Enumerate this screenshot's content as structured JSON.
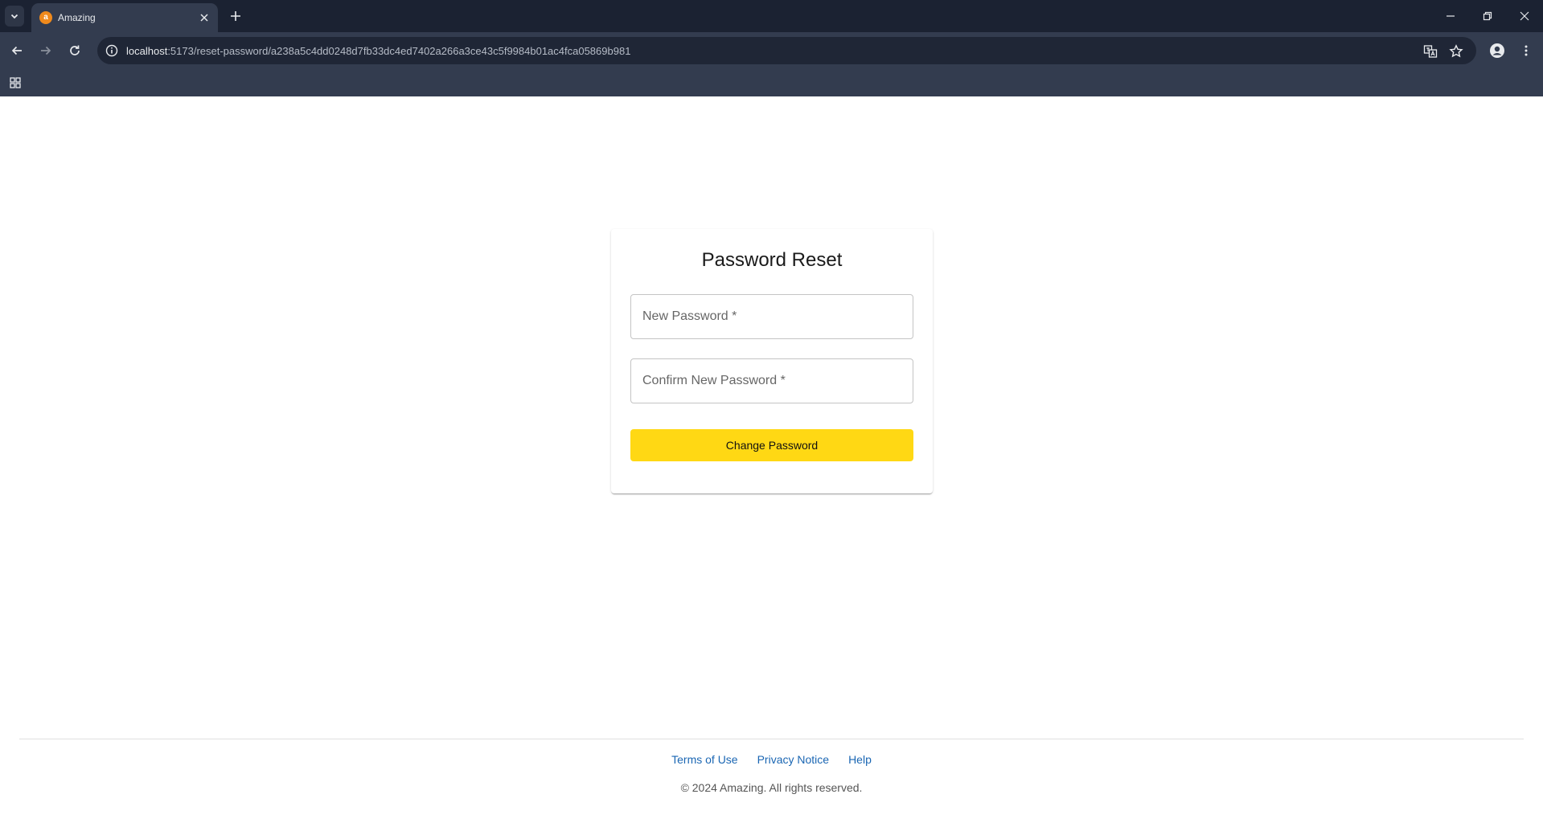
{
  "browser": {
    "tab_title": "Amazing",
    "favicon_letter": "a",
    "url_host": "localhost",
    "url_rest": ":5173/reset-password/a238a5c4dd0248d7fb33dc4ed7402a266a3ce43c5f9984b01ac4fca05869b981",
    "chrome_bg": "#1b2232",
    "toolbar_bg": "#333c4f"
  },
  "reset": {
    "title": "Password Reset",
    "new_password_placeholder": "New Password *",
    "confirm_password_placeholder": "Confirm New Password *",
    "submit_label": "Change Password",
    "button_color": "#ffd814"
  },
  "footer": {
    "links": [
      "Terms of Use",
      "Privacy Notice",
      "Help"
    ],
    "copyright": "© 2024 Amazing. All rights reserved.",
    "link_color": "#1a66b3"
  }
}
